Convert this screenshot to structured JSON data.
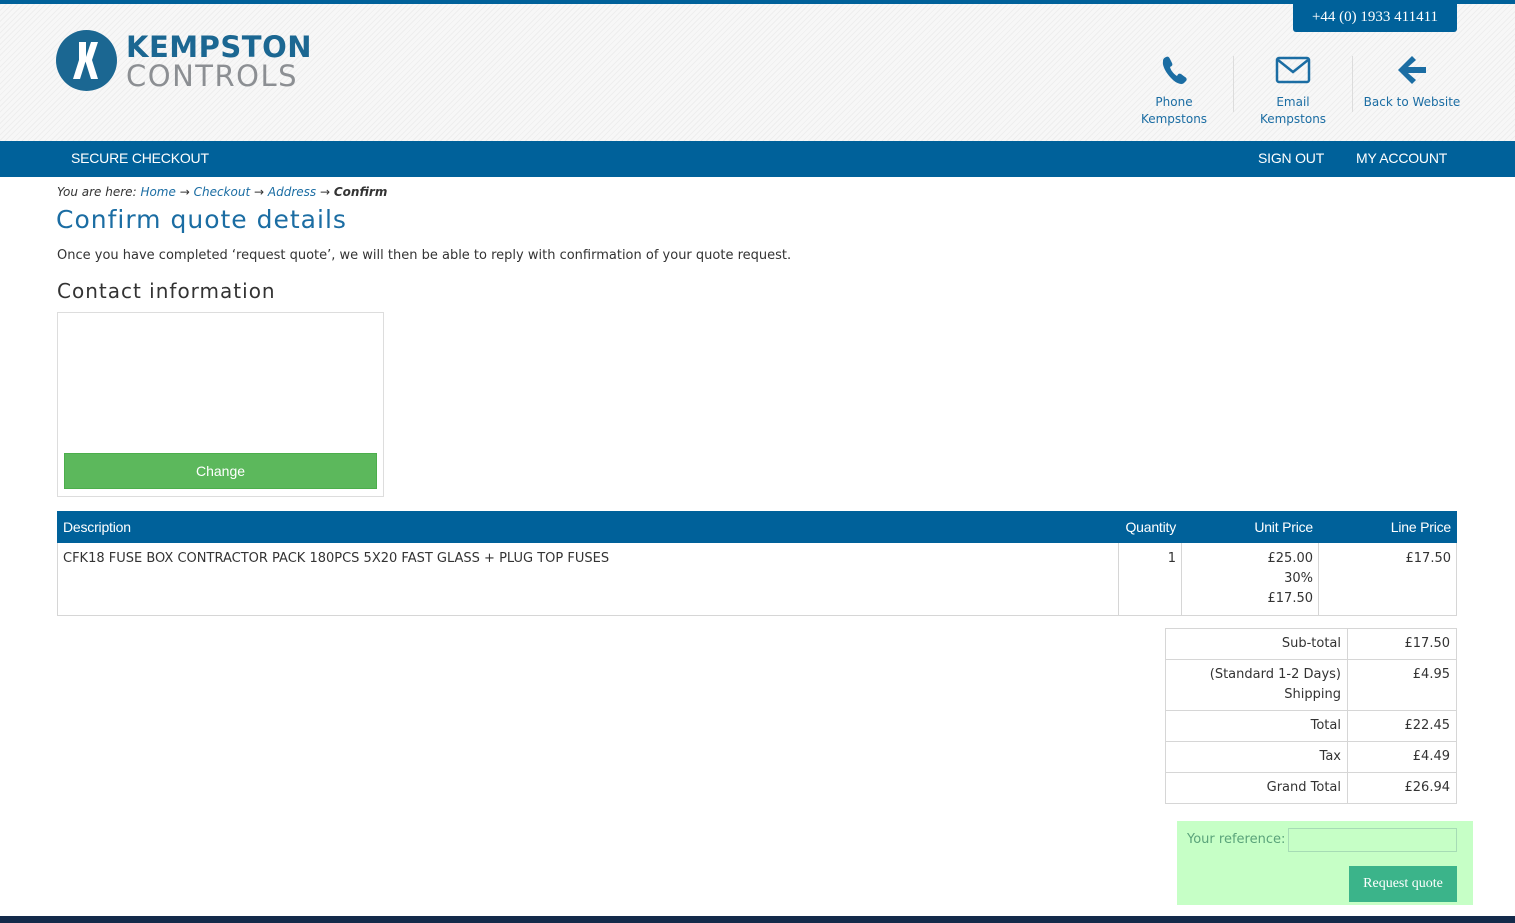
{
  "header": {
    "phone_number": "+44 (0) 1933 411411",
    "logo": {
      "line1": "KEMPSTON",
      "line2": "CONTROLS"
    },
    "links": [
      {
        "line1": "Phone",
        "line2": "Kempstons",
        "icon": "phone-icon"
      },
      {
        "line1": "Email",
        "line2": "Kempstons",
        "icon": "envelope-icon"
      },
      {
        "line1": "Back to Website",
        "icon": "arrow-left-icon"
      }
    ]
  },
  "nav": {
    "secure_checkout": "SECURE CHECKOUT",
    "sign_out": "SIGN OUT",
    "my_account": "MY ACCOUNT"
  },
  "breadcrumb": {
    "prefix": "You are here:",
    "items": [
      "Home",
      "Checkout",
      "Address"
    ],
    "current": "Confirm",
    "separator": "→"
  },
  "page": {
    "title": "Confirm quote details",
    "intro": "Once you have completed ‘request quote’, we will then be able to reply with confirmation of your quote request."
  },
  "contact": {
    "title": "Contact information",
    "change_label": "Change"
  },
  "items_table": {
    "headers": {
      "description": "Description",
      "quantity": "Quantity",
      "unit_price": "Unit Price",
      "line_price": "Line Price"
    },
    "rows": [
      {
        "description": "CFK18 FUSE BOX CONTRACTOR PACK 180PCS 5X20 FAST GLASS + PLUG TOP FUSES",
        "quantity": "1",
        "unit_price": "£25.00",
        "discount": "30%",
        "discounted_price": "£17.50",
        "line_price": "£17.50"
      }
    ]
  },
  "totals": {
    "subtotal_label": "Sub-total",
    "subtotal": "£17.50",
    "shipping_label_1": "(Standard 1-2 Days)",
    "shipping_label_2": "Shipping",
    "shipping": "£4.95",
    "total_label": "Total",
    "total": "£22.45",
    "tax_label": "Tax",
    "tax": "£4.49",
    "grand_total_label": "Grand Total",
    "grand_total": "£26.94"
  },
  "reference": {
    "label": "Your reference:",
    "value": "",
    "placeholder": "",
    "request_label": "Request quote"
  },
  "colors": {
    "brand_blue": "#00619a",
    "link_blue": "#1b6da3",
    "change_green": "#5cb85c",
    "request_green": "#3bb48a",
    "reference_panel": "#c6ffc6"
  }
}
